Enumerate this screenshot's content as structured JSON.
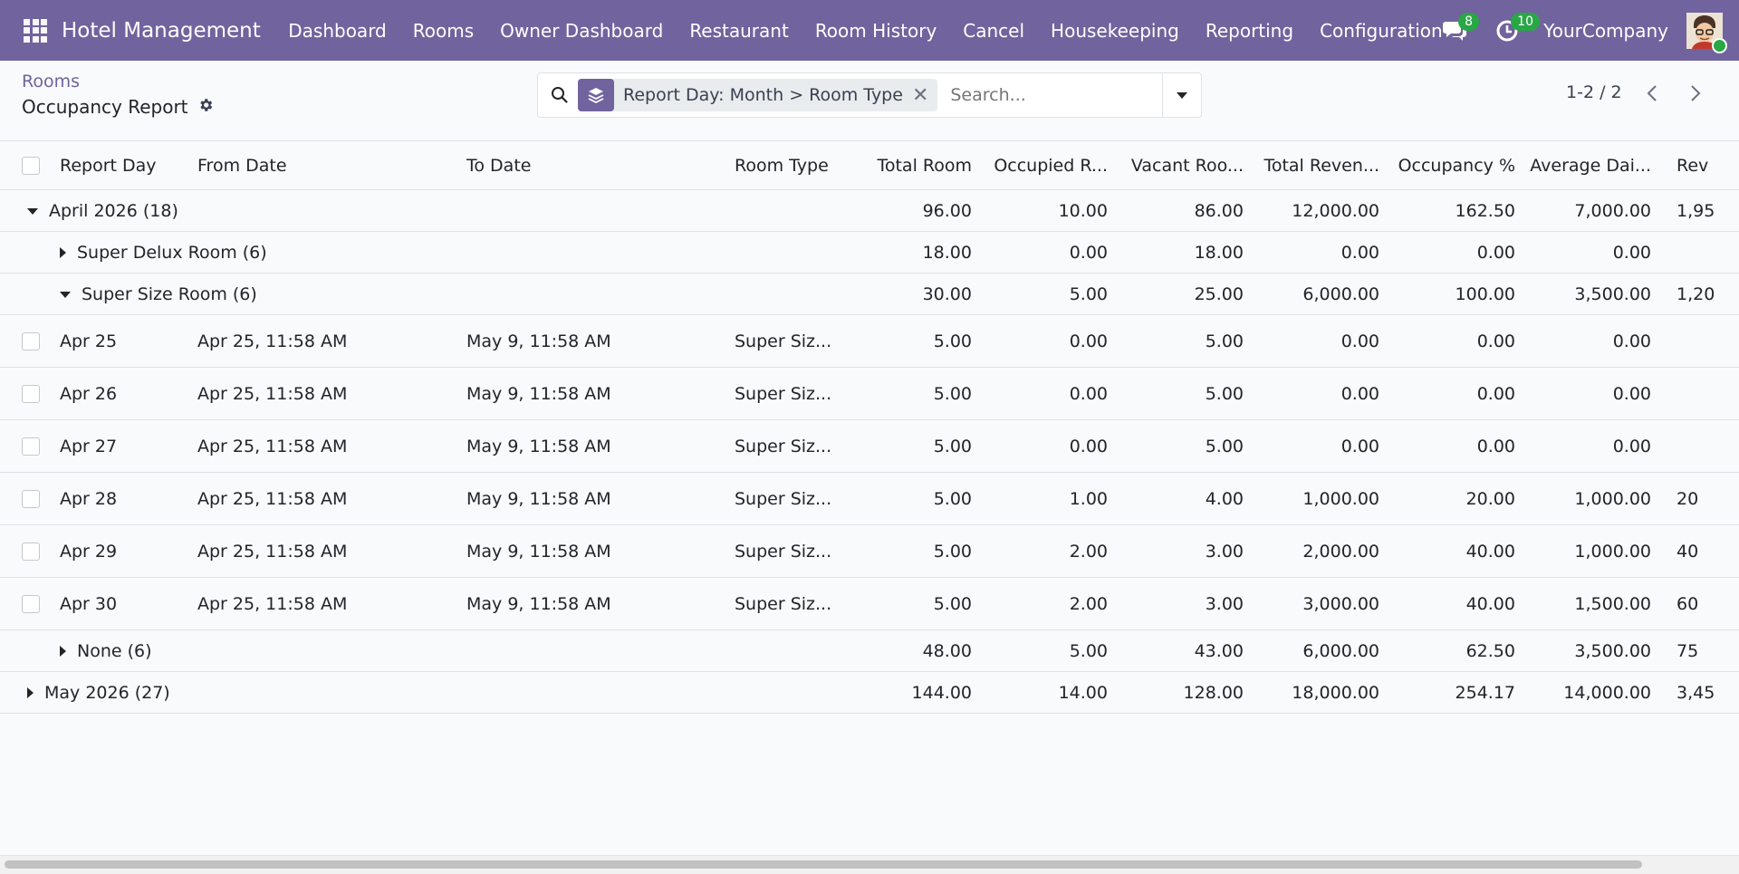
{
  "topbar": {
    "app_title": "Hotel Management",
    "menu": [
      "Dashboard",
      "Rooms",
      "Owner Dashboard",
      "Restaurant",
      "Room History",
      "Cancel",
      "Housekeeping",
      "Reporting",
      "Configuration"
    ],
    "messages_count": "8",
    "activities_count": "10",
    "company": "YourCompany"
  },
  "control_panel": {
    "breadcrumb": "Rooms",
    "title": "Occupancy Report",
    "facet": "Report Day: Month > Room Type",
    "search_placeholder": "Search...",
    "pager": "1-2 / 2"
  },
  "table": {
    "headers": [
      "Report Day",
      "From Date",
      "To Date",
      "Room Type",
      "Total Room",
      "Occupied R...",
      "Vacant Roo...",
      "Total Reven...",
      "Occupancy %",
      "Average Dai...",
      "Rev"
    ],
    "rows": [
      {
        "kind": "group",
        "level": 0,
        "open": true,
        "label": "April 2026 (18)",
        "values": [
          "96.00",
          "10.00",
          "86.00",
          "12,000.00",
          "162.50",
          "7,000.00",
          "1,95"
        ]
      },
      {
        "kind": "group",
        "level": 1,
        "open": false,
        "label": "Super Delux Room (6)",
        "values": [
          "18.00",
          "0.00",
          "18.00",
          "0.00",
          "0.00",
          "0.00",
          ""
        ]
      },
      {
        "kind": "group",
        "level": 1,
        "open": true,
        "label": "Super Size Room (6)",
        "values": [
          "30.00",
          "5.00",
          "25.00",
          "6,000.00",
          "100.00",
          "3,500.00",
          "1,20"
        ]
      },
      {
        "kind": "record",
        "cells": [
          "Apr 25",
          "Apr 25, 11:58 AM",
          "May 9, 11:58 AM",
          "Super Siz...",
          "5.00",
          "0.00",
          "5.00",
          "0.00",
          "0.00",
          "0.00",
          ""
        ]
      },
      {
        "kind": "record",
        "cells": [
          "Apr 26",
          "Apr 25, 11:58 AM",
          "May 9, 11:58 AM",
          "Super Siz...",
          "5.00",
          "0.00",
          "5.00",
          "0.00",
          "0.00",
          "0.00",
          ""
        ]
      },
      {
        "kind": "record",
        "cells": [
          "Apr 27",
          "Apr 25, 11:58 AM",
          "May 9, 11:58 AM",
          "Super Siz...",
          "5.00",
          "0.00",
          "5.00",
          "0.00",
          "0.00",
          "0.00",
          ""
        ]
      },
      {
        "kind": "record",
        "cells": [
          "Apr 28",
          "Apr 25, 11:58 AM",
          "May 9, 11:58 AM",
          "Super Siz...",
          "5.00",
          "1.00",
          "4.00",
          "1,000.00",
          "20.00",
          "1,000.00",
          "20"
        ]
      },
      {
        "kind": "record",
        "cells": [
          "Apr 29",
          "Apr 25, 11:58 AM",
          "May 9, 11:58 AM",
          "Super Siz...",
          "5.00",
          "2.00",
          "3.00",
          "2,000.00",
          "40.00",
          "1,000.00",
          "40"
        ]
      },
      {
        "kind": "record",
        "cells": [
          "Apr 30",
          "Apr 25, 11:58 AM",
          "May 9, 11:58 AM",
          "Super Siz...",
          "5.00",
          "2.00",
          "3.00",
          "3,000.00",
          "40.00",
          "1,500.00",
          "60"
        ]
      },
      {
        "kind": "group",
        "level": 1,
        "open": false,
        "label": "None (6)",
        "values": [
          "48.00",
          "5.00",
          "43.00",
          "6,000.00",
          "62.50",
          "3,500.00",
          "75"
        ]
      },
      {
        "kind": "group",
        "level": 0,
        "open": false,
        "label": "May 2026 (27)",
        "values": [
          "144.00",
          "14.00",
          "128.00",
          "18,000.00",
          "254.17",
          "14,000.00",
          "3,45"
        ]
      }
    ]
  },
  "colors": {
    "brand": "#71639e",
    "badge": "#28a745"
  },
  "icons": [
    "apps-menu-icon",
    "messages-icon",
    "activities-icon",
    "gear-icon",
    "search-icon",
    "group-by-icon",
    "close-icon",
    "caret-down-icon",
    "chevron-left-icon",
    "chevron-right-icon"
  ]
}
